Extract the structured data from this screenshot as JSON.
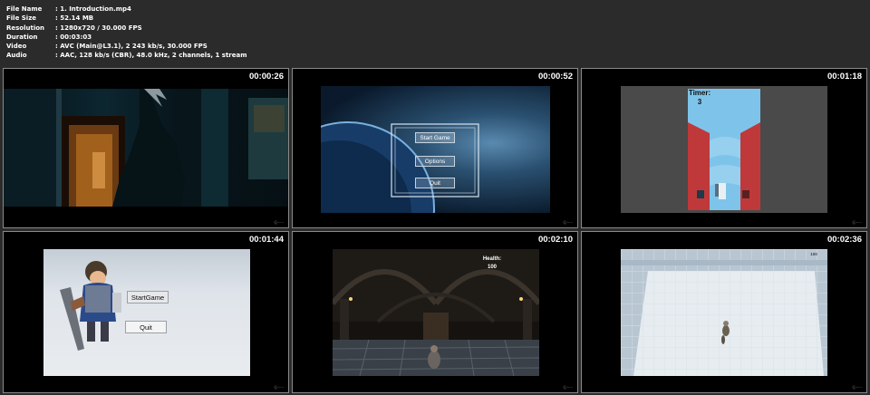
{
  "file_info": {
    "rows": [
      {
        "label": "File Name",
        "value": ":  1. Introduction.mp4"
      },
      {
        "label": "File Size",
        "value": ":  52.14 MB"
      },
      {
        "label": "Resolution",
        "value": ":  1280x720 / 30.000 FPS"
      },
      {
        "label": "Duration",
        "value": ":  00:03:03"
      },
      {
        "label": "Video",
        "value": ":  AVC (Main@L3.1), 2 243 kb/s, 30.000 FPS"
      },
      {
        "label": "Audio",
        "value": ":  AAC, 128 kb/s (CBR), 48.0 kHz, 2 channels, 1 stream"
      }
    ]
  },
  "thumbnails": [
    {
      "timestamp": "00:00:26",
      "scene": "dark cinematic scene with character silhouette in doorway"
    },
    {
      "timestamp": "00:00:52",
      "buttons": [
        "Start Game",
        "Options",
        "Quit"
      ]
    },
    {
      "timestamp": "00:01:18",
      "timer_label": "Timer:",
      "timer_value": "3"
    },
    {
      "timestamp": "00:01:44",
      "buttons": [
        "StartGame",
        "Quit"
      ]
    },
    {
      "timestamp": "00:02:10",
      "health_label": "Health:",
      "health_value": "100"
    },
    {
      "timestamp": "00:02:36",
      "corner_value": "100"
    }
  ],
  "colors": {
    "background": "#2b2b2b",
    "tile": "#000000",
    "tile_border": "#8a8a8a",
    "text": "#ffffff"
  }
}
